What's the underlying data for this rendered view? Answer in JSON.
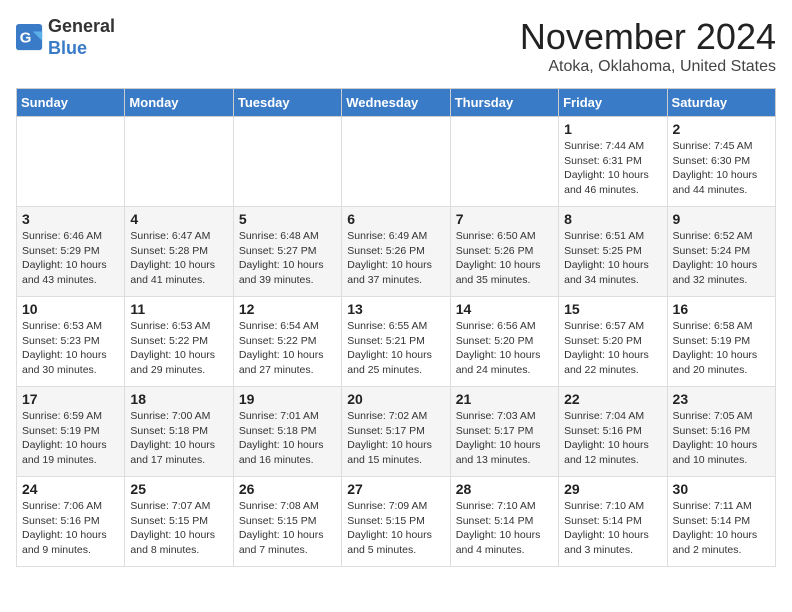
{
  "logo": {
    "line1": "General",
    "line2": "Blue"
  },
  "title": "November 2024",
  "location": "Atoka, Oklahoma, United States",
  "days_of_week": [
    "Sunday",
    "Monday",
    "Tuesday",
    "Wednesday",
    "Thursday",
    "Friday",
    "Saturday"
  ],
  "weeks": [
    [
      {
        "day": "",
        "info": ""
      },
      {
        "day": "",
        "info": ""
      },
      {
        "day": "",
        "info": ""
      },
      {
        "day": "",
        "info": ""
      },
      {
        "day": "",
        "info": ""
      },
      {
        "day": "1",
        "info": "Sunrise: 7:44 AM\nSunset: 6:31 PM\nDaylight: 10 hours\nand 46 minutes."
      },
      {
        "day": "2",
        "info": "Sunrise: 7:45 AM\nSunset: 6:30 PM\nDaylight: 10 hours\nand 44 minutes."
      }
    ],
    [
      {
        "day": "3",
        "info": "Sunrise: 6:46 AM\nSunset: 5:29 PM\nDaylight: 10 hours\nand 43 minutes."
      },
      {
        "day": "4",
        "info": "Sunrise: 6:47 AM\nSunset: 5:28 PM\nDaylight: 10 hours\nand 41 minutes."
      },
      {
        "day": "5",
        "info": "Sunrise: 6:48 AM\nSunset: 5:27 PM\nDaylight: 10 hours\nand 39 minutes."
      },
      {
        "day": "6",
        "info": "Sunrise: 6:49 AM\nSunset: 5:26 PM\nDaylight: 10 hours\nand 37 minutes."
      },
      {
        "day": "7",
        "info": "Sunrise: 6:50 AM\nSunset: 5:26 PM\nDaylight: 10 hours\nand 35 minutes."
      },
      {
        "day": "8",
        "info": "Sunrise: 6:51 AM\nSunset: 5:25 PM\nDaylight: 10 hours\nand 34 minutes."
      },
      {
        "day": "9",
        "info": "Sunrise: 6:52 AM\nSunset: 5:24 PM\nDaylight: 10 hours\nand 32 minutes."
      }
    ],
    [
      {
        "day": "10",
        "info": "Sunrise: 6:53 AM\nSunset: 5:23 PM\nDaylight: 10 hours\nand 30 minutes."
      },
      {
        "day": "11",
        "info": "Sunrise: 6:53 AM\nSunset: 5:22 PM\nDaylight: 10 hours\nand 29 minutes."
      },
      {
        "day": "12",
        "info": "Sunrise: 6:54 AM\nSunset: 5:22 PM\nDaylight: 10 hours\nand 27 minutes."
      },
      {
        "day": "13",
        "info": "Sunrise: 6:55 AM\nSunset: 5:21 PM\nDaylight: 10 hours\nand 25 minutes."
      },
      {
        "day": "14",
        "info": "Sunrise: 6:56 AM\nSunset: 5:20 PM\nDaylight: 10 hours\nand 24 minutes."
      },
      {
        "day": "15",
        "info": "Sunrise: 6:57 AM\nSunset: 5:20 PM\nDaylight: 10 hours\nand 22 minutes."
      },
      {
        "day": "16",
        "info": "Sunrise: 6:58 AM\nSunset: 5:19 PM\nDaylight: 10 hours\nand 20 minutes."
      }
    ],
    [
      {
        "day": "17",
        "info": "Sunrise: 6:59 AM\nSunset: 5:19 PM\nDaylight: 10 hours\nand 19 minutes."
      },
      {
        "day": "18",
        "info": "Sunrise: 7:00 AM\nSunset: 5:18 PM\nDaylight: 10 hours\nand 17 minutes."
      },
      {
        "day": "19",
        "info": "Sunrise: 7:01 AM\nSunset: 5:18 PM\nDaylight: 10 hours\nand 16 minutes."
      },
      {
        "day": "20",
        "info": "Sunrise: 7:02 AM\nSunset: 5:17 PM\nDaylight: 10 hours\nand 15 minutes."
      },
      {
        "day": "21",
        "info": "Sunrise: 7:03 AM\nSunset: 5:17 PM\nDaylight: 10 hours\nand 13 minutes."
      },
      {
        "day": "22",
        "info": "Sunrise: 7:04 AM\nSunset: 5:16 PM\nDaylight: 10 hours\nand 12 minutes."
      },
      {
        "day": "23",
        "info": "Sunrise: 7:05 AM\nSunset: 5:16 PM\nDaylight: 10 hours\nand 10 minutes."
      }
    ],
    [
      {
        "day": "24",
        "info": "Sunrise: 7:06 AM\nSunset: 5:16 PM\nDaylight: 10 hours\nand 9 minutes."
      },
      {
        "day": "25",
        "info": "Sunrise: 7:07 AM\nSunset: 5:15 PM\nDaylight: 10 hours\nand 8 minutes."
      },
      {
        "day": "26",
        "info": "Sunrise: 7:08 AM\nSunset: 5:15 PM\nDaylight: 10 hours\nand 7 minutes."
      },
      {
        "day": "27",
        "info": "Sunrise: 7:09 AM\nSunset: 5:15 PM\nDaylight: 10 hours\nand 5 minutes."
      },
      {
        "day": "28",
        "info": "Sunrise: 7:10 AM\nSunset: 5:14 PM\nDaylight: 10 hours\nand 4 minutes."
      },
      {
        "day": "29",
        "info": "Sunrise: 7:10 AM\nSunset: 5:14 PM\nDaylight: 10 hours\nand 3 minutes."
      },
      {
        "day": "30",
        "info": "Sunrise: 7:11 AM\nSunset: 5:14 PM\nDaylight: 10 hours\nand 2 minutes."
      }
    ]
  ]
}
